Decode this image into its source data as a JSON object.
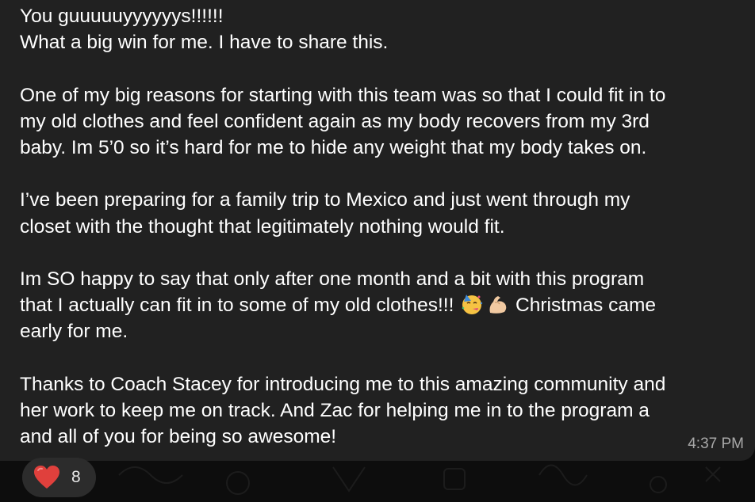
{
  "message": {
    "lines": [
      "You guuuuuyyyyyys!!!!!!",
      "What a big win for me. I have to share this.",
      "",
      "One of my big reasons for starting with this team was so that I could fit in to",
      "my old clothes and feel confident again as my body recovers from my 3rd",
      "baby. Im 5’0 so it’s hard for me to hide any weight that my body takes on.",
      "",
      "I’ve been preparing for a family trip to Mexico and just went through my",
      "closet with the thought that legitimately nothing would fit.",
      "",
      "Im SO happy to say that only after one month and a bit with this program",
      "",
      "early for me.",
      "",
      "Thanks to Coach Stacey for introducing me to this amazing community and",
      "her work to keep me on track. And Zac for helping me in to the program a",
      "and all of you for being so awesome!"
    ],
    "emoji_line": {
      "before": "that I actually can fit in to some of my old clothes!!! ",
      "emojis": [
        "partying-face-emoji",
        "flexed-biceps-emoji"
      ],
      "after": " Christmas came"
    },
    "time": "4:37 PM"
  },
  "reaction": {
    "icon": "heart-icon",
    "color": "#e0403c",
    "count": "8"
  },
  "colors": {
    "bubble": "#212121",
    "background": "#0d0d0d",
    "text": "#ffffff",
    "time": "#a8a8a8"
  }
}
